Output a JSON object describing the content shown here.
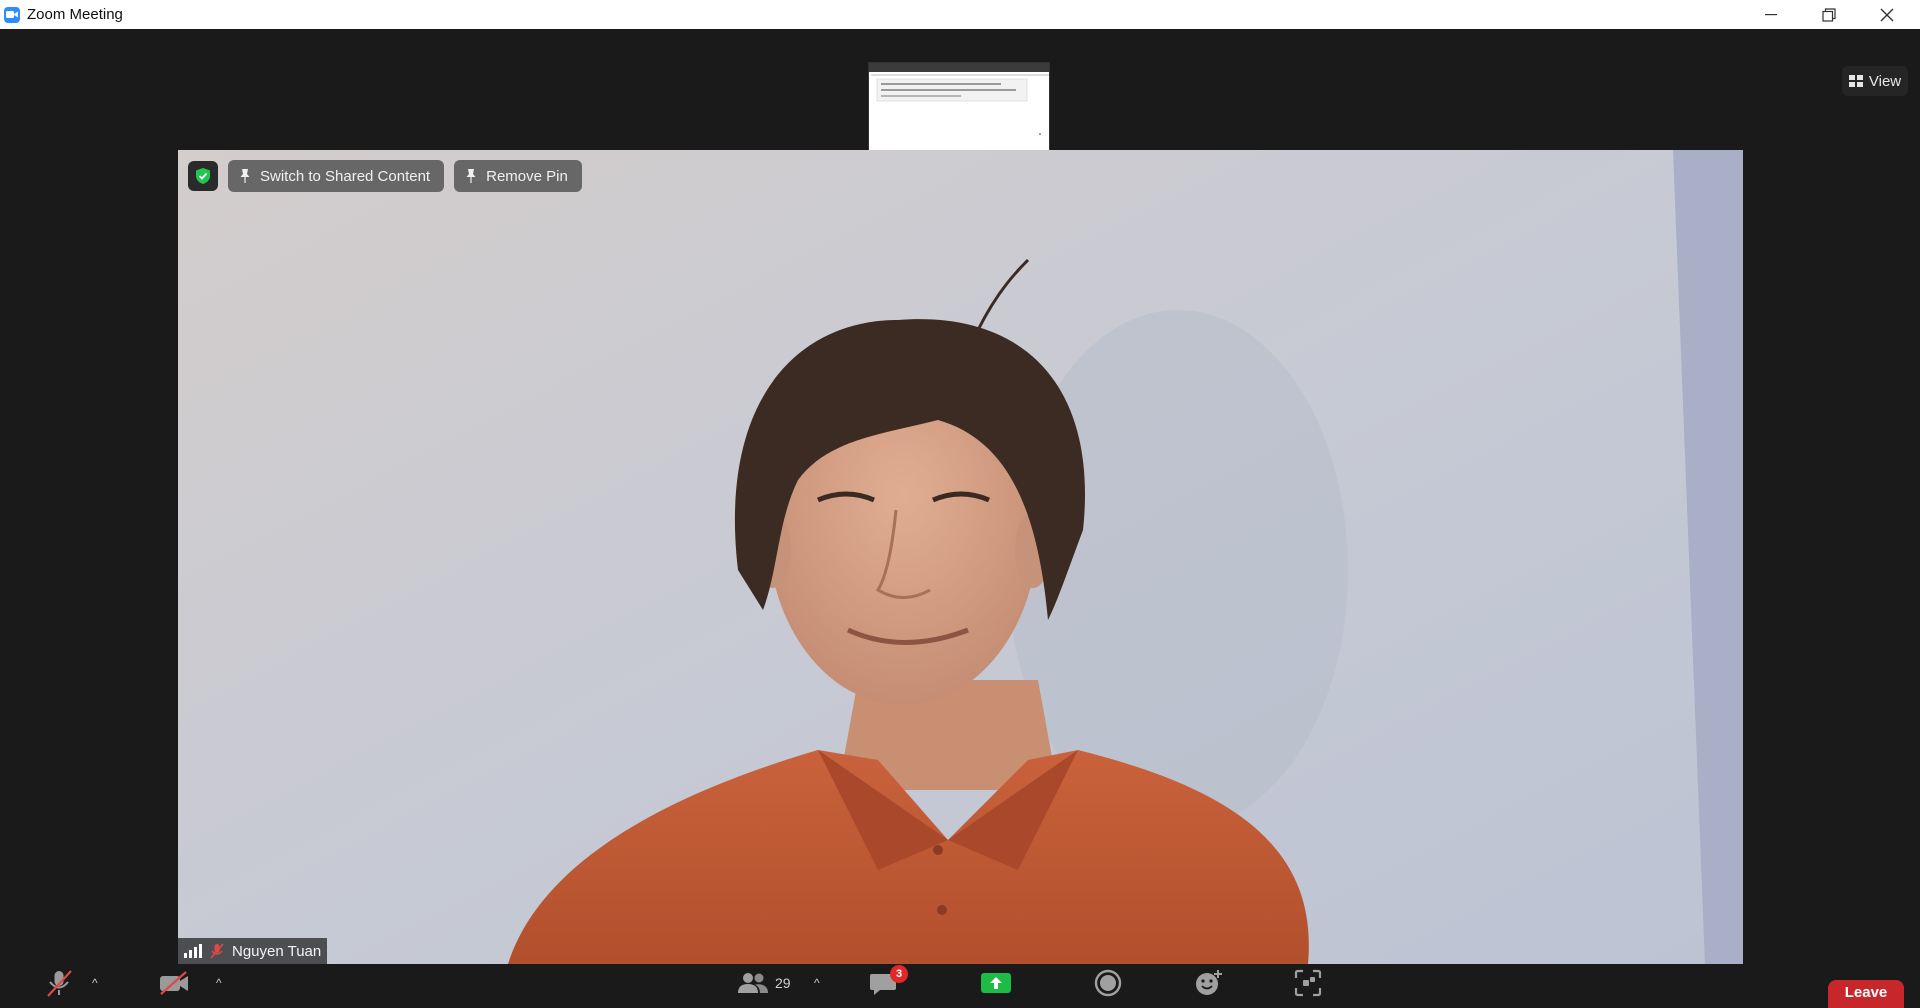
{
  "window": {
    "title": "Zoom Meeting",
    "icons": [
      "zoom-app-icon",
      "minimize-icon",
      "restore-icon",
      "close-icon"
    ]
  },
  "top": {
    "view_label": "View",
    "view_icon": "grid-icon"
  },
  "video": {
    "pin_bar": {
      "encryption_icon": "green-shield-icon",
      "switch_label": "Switch to Shared Content",
      "remove_pin_label": "Remove Pin"
    },
    "participant": {
      "name": "Nguyen Tuan",
      "audio": "muted",
      "signal_icon": "signal-bars-icon"
    }
  },
  "toolbar": {
    "participants_count": "29",
    "chat_badge": "3",
    "leave_label": "Leave",
    "icons": [
      "mic-muted-icon",
      "video-off-icon",
      "participants-icon",
      "chat-icon",
      "share-screen-icon",
      "record-icon",
      "reactions-icon",
      "apps-icon"
    ],
    "share_color": "#1fbb47",
    "leave_color": "#c7272b"
  }
}
